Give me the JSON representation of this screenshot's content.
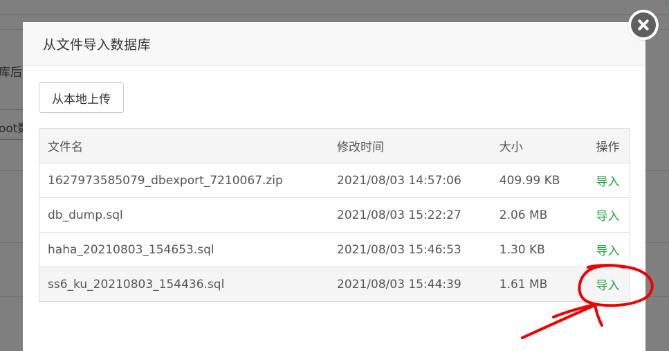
{
  "background": {
    "fragments": [
      "库后",
      "oot数"
    ]
  },
  "modal": {
    "title": "从文件导入数据库",
    "upload_label": "从本地上传",
    "table": {
      "headers": [
        "文件名",
        "修改时间",
        "大小",
        "操作"
      ],
      "rows": [
        {
          "name": "1627973585079_dbexport_7210067.zip",
          "time": "2021/08/03 14:57:06",
          "size": "409.99 KB",
          "action": "导入"
        },
        {
          "name": "db_dump.sql",
          "time": "2021/08/03 15:22:27",
          "size": "2.06 MB",
          "action": "导入"
        },
        {
          "name": "haha_20210803_154653.sql",
          "time": "2021/08/03 15:46:53",
          "size": "1.30 KB",
          "action": "导入"
        },
        {
          "name": "ss6_ku_20210803_154436.sql",
          "time": "2021/08/03 15:44:39",
          "size": "1.61 MB",
          "action": "导入"
        }
      ]
    }
  },
  "colors": {
    "action_link": "#20a53a",
    "annotation": "#ee0000",
    "overlay": "#7f7f7f"
  },
  "icons": {
    "close": "close-icon"
  }
}
